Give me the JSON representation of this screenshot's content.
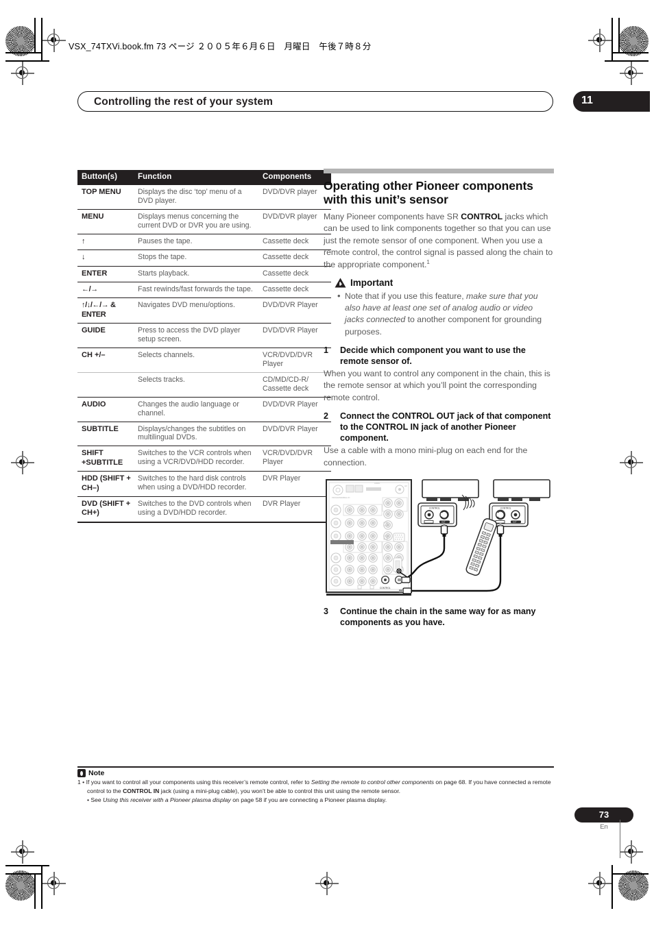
{
  "print_marks": {
    "file_line": "VSX_74TXVi.book.fm  73 ページ  ２００５年６月６日　月曜日　午後７時８分"
  },
  "running_head": {
    "title": "Controlling the rest of your system",
    "chapter_number": "11"
  },
  "table": {
    "name": "remote-button-function-table",
    "headers": [
      "Button(s)",
      "Function",
      "Components"
    ],
    "rows": [
      {
        "button": "TOP MENU",
        "function": "Displays the disc ‘top’ menu of a DVD player.",
        "components": "DVD/DVR player",
        "major": true
      },
      {
        "button": "MENU",
        "function": "Displays menus concerning the current DVD or DVR you are using.",
        "components": "DVD/DVR player",
        "major": true
      },
      {
        "button": "↑",
        "function": "Pauses the tape.",
        "components": "Cassette deck",
        "major": true,
        "is_arrow": true
      },
      {
        "button": "↓",
        "function": "Stops the tape.",
        "components": "Cassette deck",
        "major": true,
        "is_arrow": true
      },
      {
        "button": "ENTER",
        "function": "Starts playback.",
        "components": "Cassette deck",
        "major": true
      },
      {
        "button": "←/→",
        "function": "Fast rewinds/fast forwards the tape.",
        "components": "Cassette deck",
        "major": true,
        "is_arrow": true
      },
      {
        "button": "↑/↓/←/→ & ENTER",
        "function": "Navigates DVD menu/options.",
        "components": "DVD/DVR Player",
        "major": true,
        "is_arrow": true
      },
      {
        "button": "GUIDE",
        "function": "Press to access the DVD player setup screen.",
        "components": "DVD/DVR Player",
        "major": true
      },
      {
        "button": "CH +/–",
        "function": "Selects channels.",
        "components": "VCR/DVD/DVR Player",
        "major": true
      },
      {
        "button": "",
        "function": "Selects tracks.",
        "components": "CD/MD/CD-R/ Cassette deck",
        "major": false
      },
      {
        "button": "AUDIO",
        "function": "Changes the audio language or channel.",
        "components": "DVD/DVR Player",
        "major": true
      },
      {
        "button": "SUBTITLE",
        "function": "Displays/changes the subtitles on multilingual DVDs.",
        "components": "DVD/DVR Player",
        "major": true
      },
      {
        "button": "SHIFT +SUBTITLE",
        "function": "Switches to the VCR controls when using a VCR/DVD/HDD recorder.",
        "components": "VCR/DVD/DVR Player",
        "major": true
      },
      {
        "button": "HDD (SHIFT + CH–)",
        "function": "Switches to the hard disk controls when using a DVD/HDD recorder.",
        "components": "DVR Player",
        "major": true
      },
      {
        "button": "DVD (SHIFT + CH+)",
        "function": "Switches to the DVD controls when using a DVD/HDD recorder.",
        "components": "DVR Player",
        "major": true
      }
    ]
  },
  "section": {
    "heading": "Operating other Pioneer components with this unit’s sensor",
    "intro_part1": "Many Pioneer components have SR ",
    "intro_bold": "CONTROL",
    "intro_part2": " jacks which can be used to link components together so that you can use just the remote sensor of one component. When you use a remote control, the control signal is passed along the chain to the appropriate component.",
    "intro_footnote_marker": "1",
    "important_label": "Important",
    "important_bullet_pre": "Note that if you use this feature, ",
    "important_bullet_italic": "make sure that you also have at least one set of analog audio or video jacks connected",
    "important_bullet_post": " to another component for grounding purposes.",
    "steps": [
      {
        "number": "1",
        "title": "Decide which component you want to use the remote sensor of.",
        "body": "When you want to control any component in the chain, this is the remote sensor at which you’ll point the corresponding remote control."
      },
      {
        "number": "2",
        "title": "Connect the CONTROL OUT jack of that component to the CONTROL IN jack of another Pioneer component.",
        "body": "Use a cable with a mono mini-plug on each end for the connection."
      },
      {
        "number": "3",
        "title": "Continue the chain in the same way for as many components as you have.",
        "body": ""
      }
    ],
    "diagram": {
      "name": "control-chain-connection-diagram",
      "receiver_label": "CONTROL",
      "component_panel_label": "CONTROL",
      "jack_in_label": "IN",
      "jack_out_label": "OUT"
    }
  },
  "footer": {
    "note_label": "Note",
    "note_1_marker": "1",
    "note_1_pre": "If you want to control all your components using this receiver’s remote control, refer to ",
    "note_1_italic": "Setting the remote to control other components",
    "note_1_mid": " on page 68. If you have connected a remote control to the ",
    "note_1_bold": "CONTROL IN",
    "note_1_post": " jack (using a mini-plug cable), you won’t be able to control this unit using the remote sensor.",
    "note_2_pre": "See ",
    "note_2_italic": "Using this receiver with a Pioneer plasma display",
    "note_2_post": " on page 58 if you are connecting a Pioneer plasma display.",
    "page_number": "73",
    "language": "En"
  },
  "colors": {
    "ink": "#231f20",
    "body_gray": "#5b5b5b",
    "rule_gray": "#b4b4b4"
  }
}
